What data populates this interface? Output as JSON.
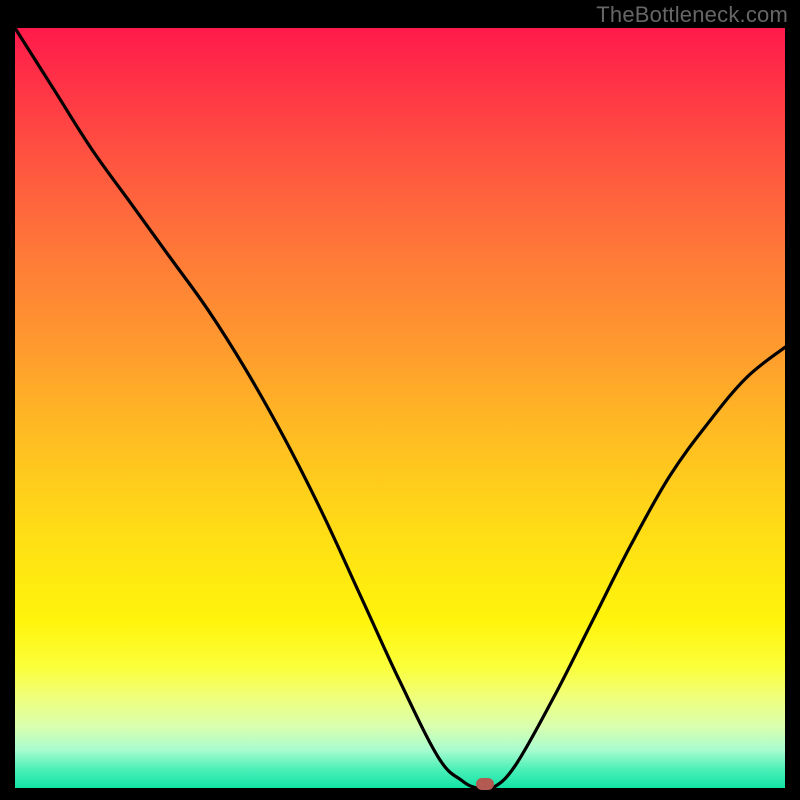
{
  "watermark": "TheBottleneck.com",
  "chart_data": {
    "type": "line",
    "title": "",
    "xlabel": "",
    "ylabel": "",
    "xlim": [
      0,
      100
    ],
    "ylim": [
      0,
      100
    ],
    "gradient_colors_top_to_bottom": [
      "#ff1a4b",
      "#ff5640",
      "#ff9a2e",
      "#ffd21a",
      "#fff40b",
      "#d8ffb0",
      "#12e3a6"
    ],
    "series": [
      {
        "name": "bottleneck-curve",
        "x": [
          0,
          5,
          10,
          15,
          20,
          25,
          30,
          35,
          40,
          45,
          50,
          55,
          58,
          60,
          62,
          65,
          70,
          75,
          80,
          85,
          90,
          95,
          100
        ],
        "y": [
          100,
          92,
          84,
          77,
          70,
          63,
          55,
          46,
          36,
          25,
          14,
          4,
          1,
          0,
          0,
          3,
          12,
          22,
          32,
          41,
          48,
          54,
          58
        ]
      }
    ],
    "marker": {
      "x": 61,
      "y": 0.5,
      "color": "#b35a52",
      "name": "optimal-point"
    },
    "marker_label": ""
  }
}
